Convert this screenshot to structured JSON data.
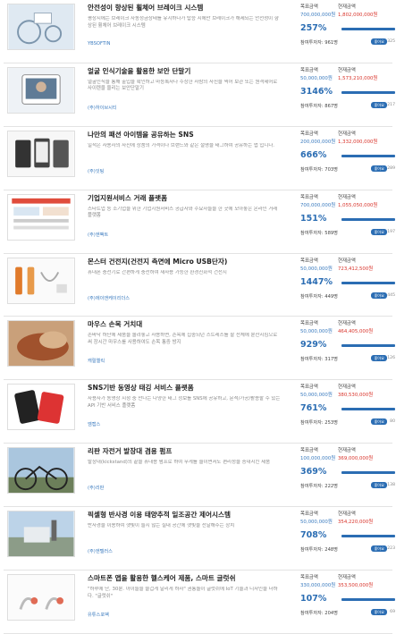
{
  "labels": {
    "goal": "목표금액",
    "current": "현재금액",
    "investors": "참여투자자:",
    "pill": "좋아요"
  },
  "colors": {
    "accent": "#2b6db3",
    "current_amount": "#d9342b",
    "company": "#3b7bbf"
  },
  "items": [
    {
      "title": "안전성이 향상된 휠체어 브레이크 시스템",
      "desc": "평상시에는 브레이크 자동정금상태를 유지하다가 탑승 시에만 브레이크가 해제되는 안전성이 향상된 휠체어 브레이크 시스템",
      "company": "YBSOFTIN",
      "goal": "700,000,000원",
      "current": "1,802,000,000원",
      "percent": "257%",
      "progress": 1.0,
      "investors": "961명",
      "likes": "325",
      "icon": "wheelchair-image"
    },
    {
      "title": "얼굴 인식기술을 활용한 보안 단말기",
      "desc": "얼굴인식을 통해 출입을 확인하고 마등록자나 수상한 사람의 사진을 찍어 보관 또는 원격제어로 사이렌을 울리는 보안단말기",
      "company": "(주)하이브시티",
      "goal": "50,000,000원",
      "current": "1,573,210,000원",
      "percent": "3146%",
      "progress": 1.0,
      "investors": "867명",
      "likes": "217",
      "icon": "face-device-image"
    },
    {
      "title": "나만의 패션 아이템을 공유하는 SNS",
      "desc": "일적은 사용자의 사진에 상품의 가격이나 브랜드와 같은 설명을 태그하여 공유하는 앱 입니다.",
      "company": "(주)잇팅",
      "goal": "200,000,000원",
      "current": "1,332,000,000원",
      "percent": "666%",
      "progress": 1.0,
      "investors": "703명",
      "likes": "289",
      "icon": "phone-app-image"
    },
    {
      "title": "기업지원서비스 거래 플랫폼",
      "desc": "스타트업 등 소기업을 위한 기업지원서비스 공급자와 수요자들을 한 곳에 모아놓은 온라인 거래 플랫폼",
      "company": "(주)엔팩트",
      "goal": "700,000,000원",
      "current": "1,055,050,000원",
      "percent": "151%",
      "progress": 1.0,
      "investors": "589명",
      "likes": "197",
      "icon": "website-image"
    },
    {
      "title": "몬스터 건전지(건전지 측면에 Micro USB단자)",
      "desc": "휴대폰 충전기로 간편하게 충전하여 재사용 가능한 환경친화적 건전지",
      "company": "(주)에이앤케이리더스",
      "goal": "50,000,000원",
      "current": "723,412,500원",
      "percent": "1447%",
      "progress": 1.0,
      "investors": "449명",
      "likes": "445",
      "icon": "battery-image"
    },
    {
      "title": "마우스 손목 거치대",
      "desc": "손바닥 하단에 제품을 올려놓고 사용하면, 손목에 집중되던 스트레스를 팔 전체에 분산시킴으로써 장시간 마우스를 사용하여도 손목 통증 방지",
      "company": "캐릴엘릭",
      "goal": "50,000,000원",
      "current": "464,405,000원",
      "percent": "929%",
      "progress": 1.0,
      "investors": "317명",
      "likes": "126",
      "icon": "wrist-rest-image"
    },
    {
      "title": "SNS기반 동영상 태깅 서비스 플랫폼",
      "desc": "사용자가 동영상 시청 중 만나는 다양한 태그 정보를 SNS에 공유하고, 문석/가공/활용할 수 있는 API 기반 서비스 플랫폼",
      "company": "엠캡스",
      "goal": "50,000,000원",
      "current": "380,530,000원",
      "percent": "761%",
      "progress": 1.0,
      "investors": "253명",
      "likes": "80",
      "icon": "video-app-image"
    },
    {
      "title": "리판 자전거 발장대 겸용 펌프",
      "desc": "발장대(kickstand)의 끝을 휴대용 펌프로 하여 무게를 줄이면서도 편리성을 증대시킨 제품",
      "company": "(주)리판",
      "goal": "100,000,000원",
      "current": "369,000,000원",
      "percent": "369%",
      "progress": 1.0,
      "investors": "222명",
      "likes": "138",
      "icon": "bicycle-image"
    },
    {
      "title": "픽셀형 반사경 이용 태양추적 일조공간 제어시스템",
      "desc": "반사경을 이용하여 햇빛이 들지 않는 실내 공간에 햇빛을 전달해주는 장치",
      "company": "(주)엔텔러스",
      "goal": "50,000,000원",
      "current": "354,220,000원",
      "percent": "708%",
      "progress": 1.0,
      "investors": "248명",
      "likes": "223",
      "icon": "reflector-image"
    },
    {
      "title": "스마트폰 앱을 활용한 헬스케어 제품, 스마트 글럿쉬",
      "desc": "\"하루에 단, 30분. 아이들을 즐겁게 달리게 하자\" 권통놀이 글럿쉬에 IoT 기술과 디자인을 더하다. \"글럿쉬\"",
      "company": "유튜스포벡",
      "goal": "330,000,000원",
      "current": "353,500,000원",
      "percent": "107%",
      "progress": 1.0,
      "investors": "204명",
      "likes": "69",
      "icon": "healthcare-device-image"
    }
  ]
}
